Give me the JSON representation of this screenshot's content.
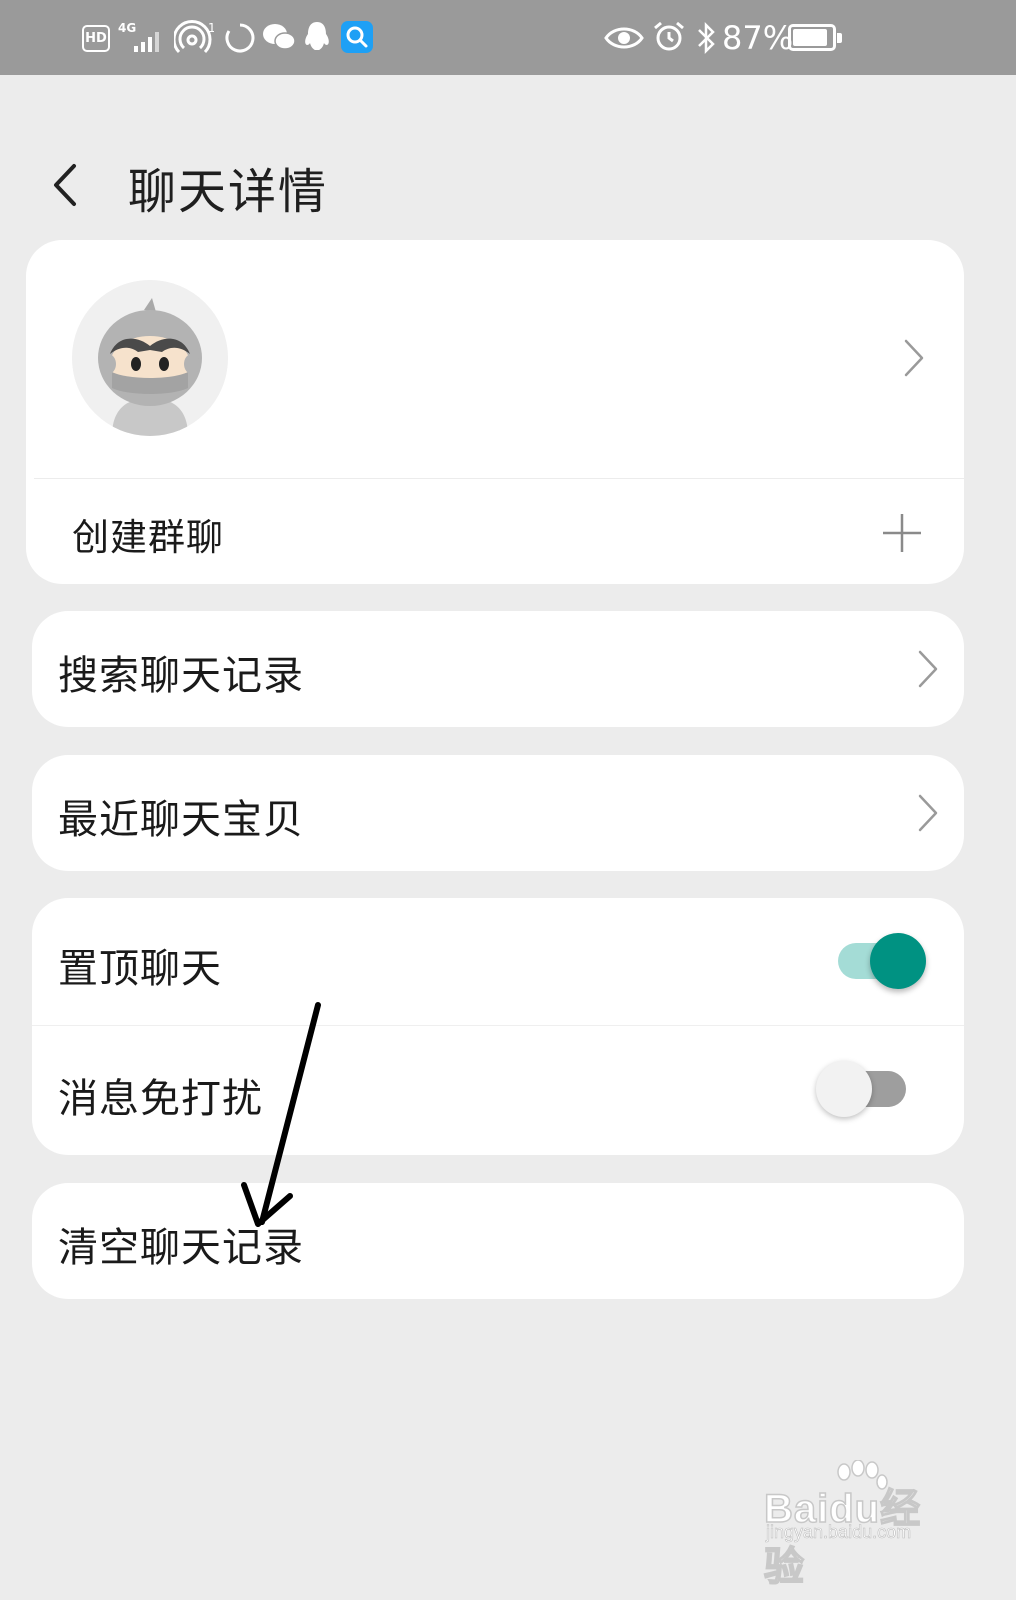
{
  "status_bar": {
    "hd_label": "HD",
    "network_label": "4G",
    "battery_percent": "87%",
    "icons": [
      "hd-icon",
      "signal-icon",
      "hotspot-icon",
      "loading-icon",
      "wechat-icon",
      "qq-icon",
      "search-app-icon",
      "eye-icon",
      "alarm-icon",
      "bluetooth-icon",
      "battery-icon"
    ]
  },
  "header": {
    "title": "聊天详情"
  },
  "profile_card": {
    "create_group_label": "创建群聊"
  },
  "menu": {
    "search_history": "搜索聊天记录",
    "recent_items": "最近聊天宝贝",
    "pin_chat": "置顶聊天",
    "pin_chat_on": true,
    "do_not_disturb": "消息免打扰",
    "do_not_disturb_on": false,
    "clear_history": "清空聊天记录"
  },
  "colors": {
    "accent": "#009282",
    "accent_light": "#a4dcd6",
    "background": "#ececec",
    "status_bar": "#9a9a9a"
  },
  "watermark": {
    "brand": "Baidu经验",
    "url": "jingyan.baidu.com"
  }
}
